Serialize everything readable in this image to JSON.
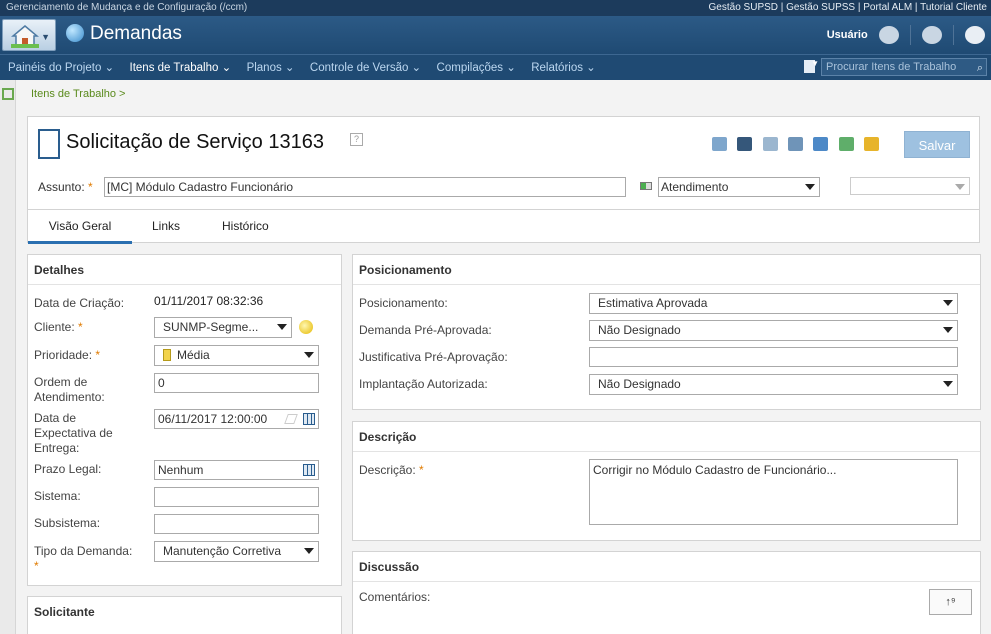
{
  "topbar": {
    "app_title": "Gerenciamento de Mudança e de Configuração (/ccm)",
    "links": "Gestão SUPSD | Gestão SUPSS | Portal ALM | Tutorial Cliente"
  },
  "header": {
    "project_title": "Demandas",
    "user": "Usuário"
  },
  "nav": {
    "items": [
      "Painéis do Projeto ⌄",
      "Itens de Trabalho ⌄",
      "Planos ⌄",
      "Controle de Versão ⌄",
      "Compilações ⌄",
      "Relatórios ⌄"
    ],
    "search_placeholder": "Procurar Itens de Trabalho"
  },
  "breadcrumb": "Itens de Trabalho >",
  "work_item": {
    "title": "Solicitação de Serviço 13163",
    "save_label": "Salvar",
    "subject_label": "Assunto:",
    "subject_value": "[MC] Módulo Cadastro Funcionário",
    "state": "Atendimento"
  },
  "tabs": [
    "Visão Geral",
    "Links",
    "Histórico"
  ],
  "details": {
    "heading": "Detalhes",
    "created_label": "Data de Criação:",
    "created_value": "01/11/2017 08:32:36",
    "client_label": "Cliente:",
    "client_value": "SUNMP-Segme...",
    "priority_label": "Prioridade:",
    "priority_value": "Média",
    "order_label": "Ordem de Atendimento:",
    "order_value": "0",
    "expected_label": "Data de Expectativa de Entrega:",
    "expected_value": "06/11/2017 12:00:00",
    "legal_label": "Prazo Legal:",
    "legal_value": "Nenhum",
    "system_label": "Sistema:",
    "subsystem_label": "Subsistema:",
    "type_label": "Tipo da Demanda:",
    "type_value": "Manutenção Corretiva"
  },
  "requester": {
    "heading": "Solicitante"
  },
  "positioning": {
    "heading": "Posicionamento",
    "pos_label": "Posicionamento:",
    "pos_value": "Estimativa Aprovada",
    "preapproved_label": "Demanda Pré-Aprovada:",
    "preapproved_value": "Não Designado",
    "justification_label": "Justificativa Pré-Aprovação:",
    "deploy_label": "Implantação Autorizada:",
    "deploy_value": "Não Designado"
  },
  "description": {
    "heading": "Descrição",
    "label": "Descrição:",
    "value": "Corrigir no Módulo Cadastro de Funcionário..."
  },
  "discussion": {
    "heading": "Discussão",
    "comments_label": "Comentários:",
    "sort_label": "↑⁹"
  }
}
